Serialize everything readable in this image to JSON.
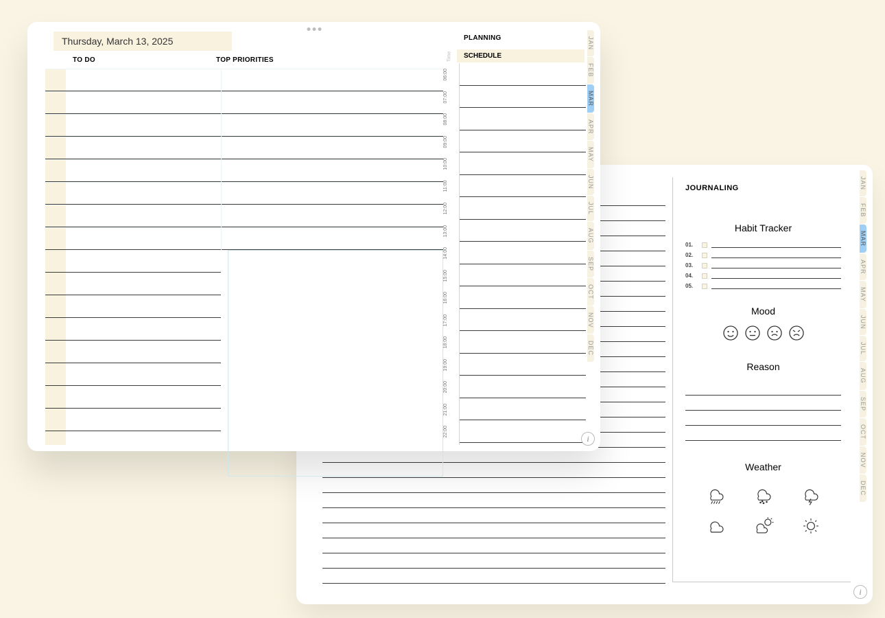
{
  "page1": {
    "date": "Thursday, March 13, 2025",
    "todo_header": "TO DO",
    "priorities_header": "TOP PRIORITIES",
    "planning_header": "PLANNING",
    "schedule_header": "SCHEDULE",
    "time_header": "Time",
    "times": [
      "06:00",
      "07:00",
      "08:00",
      "09:00",
      "10:00",
      "11:00",
      "12:00",
      "13:00",
      "14:00",
      "15:00",
      "16:00",
      "17:00",
      "18:00",
      "19:00",
      "20:00",
      "21:00",
      "22:00"
    ],
    "months": [
      "JAN",
      "FEB",
      "MAR",
      "APR",
      "MAY",
      "JUN",
      "JUL",
      "AUG",
      "SEP",
      "OCT",
      "NOV",
      "DEC"
    ],
    "active_month_index": 2,
    "info": "i"
  },
  "page2": {
    "journaling_header": "JOURNALING",
    "habit_tracker": "Habit Tracker",
    "habit_numbers": [
      "01.",
      "02.",
      "03.",
      "04.",
      "05."
    ],
    "mood": "Mood",
    "reason": "Reason",
    "weather": "Weather",
    "months": [
      "JAN",
      "FEB",
      "MAR",
      "APR",
      "MAY",
      "JUN",
      "JUL",
      "AUG",
      "SEP",
      "OCT",
      "NOV",
      "DEC"
    ],
    "active_month_index": 2,
    "info": "i"
  }
}
